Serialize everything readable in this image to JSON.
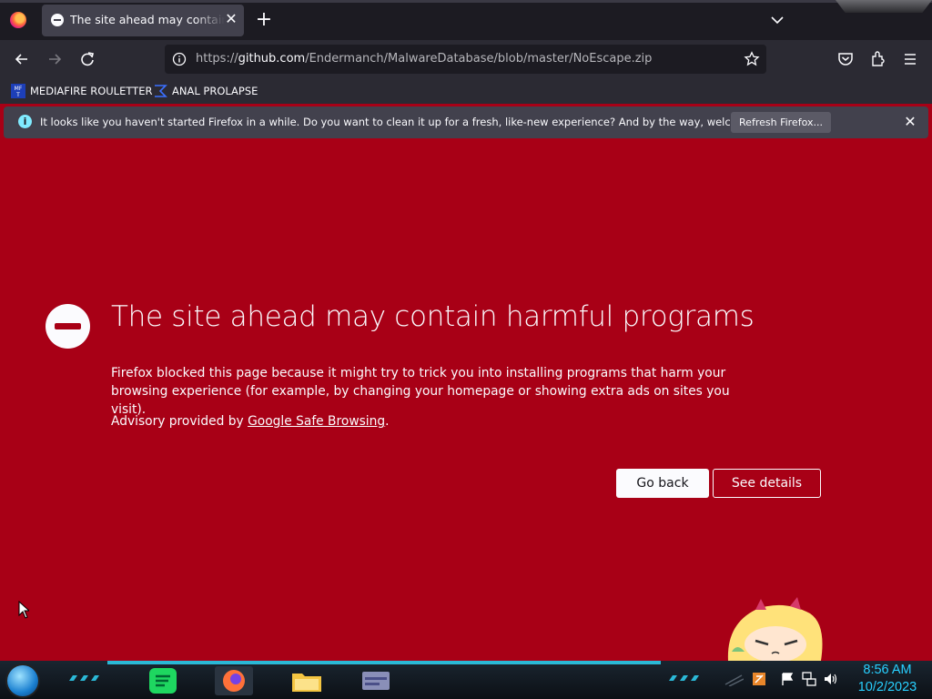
{
  "browser": {
    "tab": {
      "title": "The site ahead may contain harmful programs",
      "close": "✕"
    },
    "new_tab": "+",
    "url": {
      "prefix": "https://",
      "host": "github.com",
      "path": "/Endermanch/MalwareDatabase/blob/master/NoEscape.zip"
    },
    "bookmarks": [
      {
        "label": "MEDIAFIRE ROULETTER"
      },
      {
        "label": "ANAL PROLAPSE"
      }
    ],
    "notification": {
      "text": "It looks like you haven't started Firefox in a while. Do you want to clean it up for a fresh, like-new experience? And by the way, welcome back!",
      "button": "Refresh Firefox...",
      "close": "✕"
    }
  },
  "page": {
    "title": "The site ahead may contain harmful programs",
    "description": "Firefox blocked this page because it might try to trick you into installing programs that harm your browsing experience (for example, by changing your homepage or showing extra ads on sites you visit).",
    "advisory_prefix": "Advisory provided by ",
    "advisory_link": "Google Safe Browsing",
    "advisory_suffix": ".",
    "go_back": "Go back",
    "see_details": "See details"
  },
  "taskbar": {
    "time": "8:56 AM",
    "date": "10/2/2023"
  },
  "colors": {
    "page_background": "#a80016",
    "accent": "#28d0ff"
  }
}
